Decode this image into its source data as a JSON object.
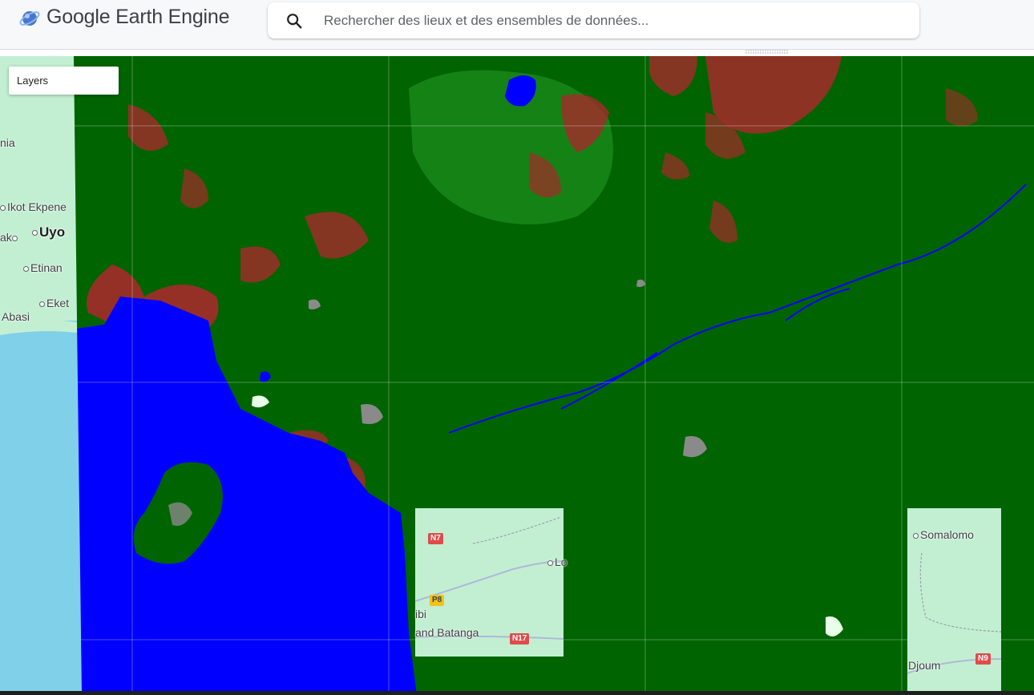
{
  "header": {
    "brand": "Google Earth Engine",
    "search_placeholder": "Rechercher des lieux et des ensembles de données..."
  },
  "map": {
    "layers_label": "Layers",
    "places": {
      "nia": "nia",
      "ikot_ekpene": "Ikot Ekpene",
      "uyo": "Uyo",
      "ak": "ak",
      "etinan": "Etinan",
      "eket": "Eket",
      "abasi": "Abasi",
      "lo": "Lo",
      "ibi": "ibi",
      "kribi_batanga": "and Batanga",
      "somalomo": "Somalomo",
      "djoum": "Djoum"
    },
    "road_shields": {
      "n7": "N7",
      "p8": "P8",
      "n17": "N17",
      "n9": "N9"
    }
  },
  "colors": {
    "forest": "#006400",
    "water": "#0000ff",
    "cropland": "#a52a2a",
    "grass": "#1a8a1a",
    "basemap": "#c2efd2",
    "ocean_base": "#7fd0e8"
  }
}
